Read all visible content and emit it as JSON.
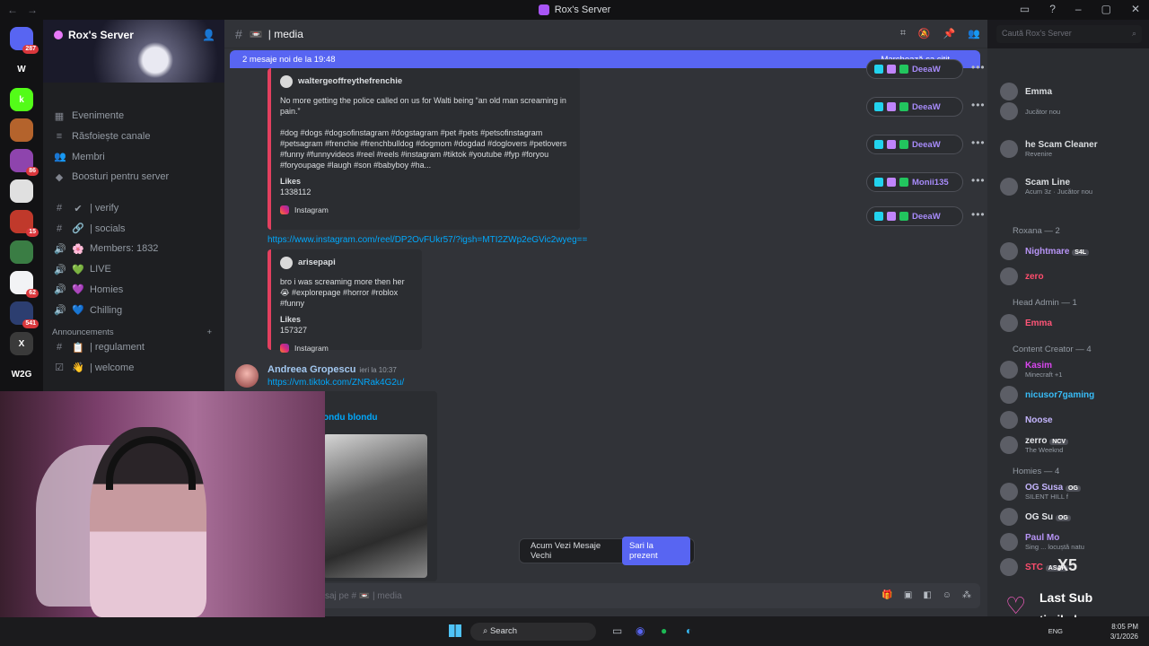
{
  "window": {
    "title": "Rox's Server"
  },
  "servers": [
    {
      "badge": "287",
      "color": "#5865f2"
    },
    {
      "badge": "",
      "color": "#121214",
      "label": "W"
    },
    {
      "badge": "",
      "color": "#53fc18",
      "label": "k"
    },
    {
      "badge": "",
      "color": "#b4632c"
    },
    {
      "badge": "86",
      "color": "#8e44ad"
    },
    {
      "badge": "",
      "color": "#e0e0e0"
    },
    {
      "badge": "15",
      "color": "#c0392b"
    },
    {
      "badge": "",
      "color": "#3a7d44"
    },
    {
      "badge": "62",
      "color": "#f2f3f5"
    },
    {
      "badge": "541",
      "color": "#2c3e70"
    },
    {
      "badge": "",
      "color": "#3a3a3a",
      "label": "X"
    },
    {
      "badge": "",
      "color": "#121214",
      "label": "W2G"
    },
    {
      "badge": "",
      "color": "#7a6a5a"
    }
  ],
  "sidebar": {
    "server_name": "Rox's Server",
    "menu": [
      "Evenimente",
      "Răsfoiește canale",
      "Membri",
      "Boosturi pentru server"
    ],
    "channels": [
      {
        "icon": "#",
        "emoji": "✔",
        "label": "| verify"
      },
      {
        "icon": "#",
        "emoji": "🔗",
        "label": "| socials"
      },
      {
        "icon": "🔊",
        "emoji": "🌸",
        "label": "Members: 1832"
      },
      {
        "icon": "🔊",
        "emoji": "💚",
        "label": "LIVE"
      },
      {
        "icon": "🔊",
        "emoji": "💜",
        "label": "Homies"
      },
      {
        "icon": "🔊",
        "emoji": "💙",
        "label": "Chilling"
      }
    ],
    "category": "Announcements",
    "announce_channels": [
      {
        "icon": "#",
        "emoji": "📋",
        "label": "| regulament"
      },
      {
        "icon": "☑",
        "emoji": "👋",
        "label": "| welcome"
      }
    ]
  },
  "chat": {
    "channel": "| media",
    "new_messages": "2 mesaje noi de la 19:48",
    "mark_read": "Marchează ca citit",
    "embed1": {
      "author": "waltergeoffreythefrenchie",
      "text": "No more getting the police called on us for Walti being “an old man screaming in pain.”",
      "tags": "#dog #dogs #dogsofinstagram #dogstagram #pet #pets #petsofinstagram #petsagram #frenchie #frenchbulldog #dogmom #dogdad #doglovers #petlovers #funny #funnyvideos #reel #reels #instagram #tiktok #youtube #fyp #foryou #foryoupage #laugh #son #babyboy #ha...",
      "likes_label": "Likes",
      "likes": "1338112",
      "footer": "Instagram"
    },
    "link2": "https://www.instagram.com/reel/DP2OvFUkr57/?igsh=MTI2ZWp2eGVic2wyeg==",
    "embed2": {
      "author": "arisepapi",
      "text": "bro i was screaming more then her 😭 #explorepage #horror #roblox #funny",
      "likes_label": "Likes",
      "likes": "157327",
      "footer": "Instagram"
    },
    "message": {
      "author": "Andreea Gropescu",
      "time": "ieri la 10:37",
      "link": "https://vm.tiktok.com/ZNRak4G2u/",
      "embed_title": "ondu blondu"
    },
    "jump": {
      "label": "Acum Vezi Mesaje Vechi",
      "button": "Sari la prezent"
    },
    "composer_placeholder": "saj pe # 📼 | media",
    "composer_channel": "| media"
  },
  "pills": [
    {
      "name": "DeeaW"
    },
    {
      "name": "DeeaW"
    },
    {
      "name": "DeeaW"
    },
    {
      "name": "Monii135"
    },
    {
      "name": "DeeaW"
    }
  ],
  "search": {
    "placeholder": "Caută Rox's Server"
  },
  "members": {
    "top": [
      {
        "name": "Emma",
        "sub": ""
      },
      {
        "name": "",
        "sub": "Jucător nou"
      },
      {
        "name": "he Scam Cleaner",
        "sub": "Revenire"
      },
      {
        "name": "Scam Line",
        "sub": "Acum 3z · Jucător nou"
      }
    ],
    "groups": [
      {
        "title": "Roxana — 2",
        "items": [
          {
            "name": "Nightmare",
            "tag": "S4L",
            "sub": ""
          },
          {
            "name": "zero",
            "tag": "",
            "sub": ""
          }
        ]
      },
      {
        "title": "Head Admin — 1",
        "items": [
          {
            "name": "Emma",
            "tag": "",
            "sub": ""
          }
        ]
      },
      {
        "title": "Content Creator — 4",
        "items": [
          {
            "name": "Kasim",
            "tag": "",
            "sub": "Minecraft +1"
          },
          {
            "name": "nicusor7gaming",
            "tag": "",
            "sub": ""
          },
          {
            "name": "Noose",
            "tag": "",
            "sub": ""
          },
          {
            "name": "zerro",
            "tag": "NCV",
            "sub": "The Weeknd"
          }
        ]
      },
      {
        "title": "Homies — 4",
        "items": [
          {
            "name": "OG Susa",
            "tag": "OG",
            "sub": "SILENT HILL f"
          },
          {
            "name": "OG Su",
            "tag": "OG",
            "sub": ""
          },
          {
            "name": "Paul Mo",
            "tag": "",
            "sub": "Sing ... locuștă natu"
          },
          {
            "name": "STC",
            "tag": "ASAP",
            "sub": ""
          }
        ]
      }
    ]
  },
  "overlay": {
    "multiplier": "X5",
    "label": "Last Sub",
    "user": "timihxh"
  },
  "taskbar": {
    "search": "Search",
    "lang": "ENG",
    "time": "8:05 PM",
    "date": "3/1/2026"
  },
  "colors": {
    "accent": "#5865f2",
    "link": "#00a8fc",
    "instagram": "#e4405f"
  }
}
